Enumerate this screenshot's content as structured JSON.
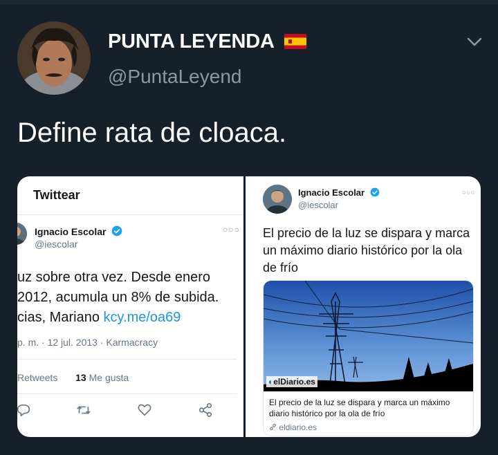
{
  "tweet": {
    "display_name": "PUNTA LEYENDA",
    "handle": "@PuntaLeyend",
    "text": "Define rata de cloaca."
  },
  "left_card": {
    "header": "Twittear",
    "author_name": "Ignacio Escolar",
    "author_handle": "@iescolar",
    "body_lines": [
      "uz sobre otra vez. Desde enero",
      "2012, acumula un 8% de subida.",
      "cias, Mariano "
    ],
    "link": "kcy.me/oa69",
    "meta": "p. m. · 12 jul. 2013 · Karmacracy",
    "retweets_label": "Retweets",
    "likes_count": "13",
    "likes_label": "Me gusta"
  },
  "right_card": {
    "author_name": "Ignacio Escolar",
    "author_handle": "@iescolar",
    "body": "El precio de la luz se dispara y marca un máximo diario histórico por la ola de frío",
    "link_source": "elDiario.es",
    "link_title": "El precio de la luz se dispara y marca un máximo diario histórico por la ola de frío",
    "link_domain": "eldiario.es"
  },
  "icons": {
    "flag": "spain-flag-icon",
    "verified": "verified-badge-icon",
    "more": "more-dots-icon",
    "chevron": "chevron-down-icon",
    "reply": "reply-icon",
    "retweet": "retweet-icon",
    "like": "heart-icon",
    "share": "share-icon",
    "link": "link-icon"
  },
  "colors": {
    "background": "#15202b",
    "muted": "#8899a6",
    "link": "#1b95e0",
    "verified": "#1da1f2"
  }
}
